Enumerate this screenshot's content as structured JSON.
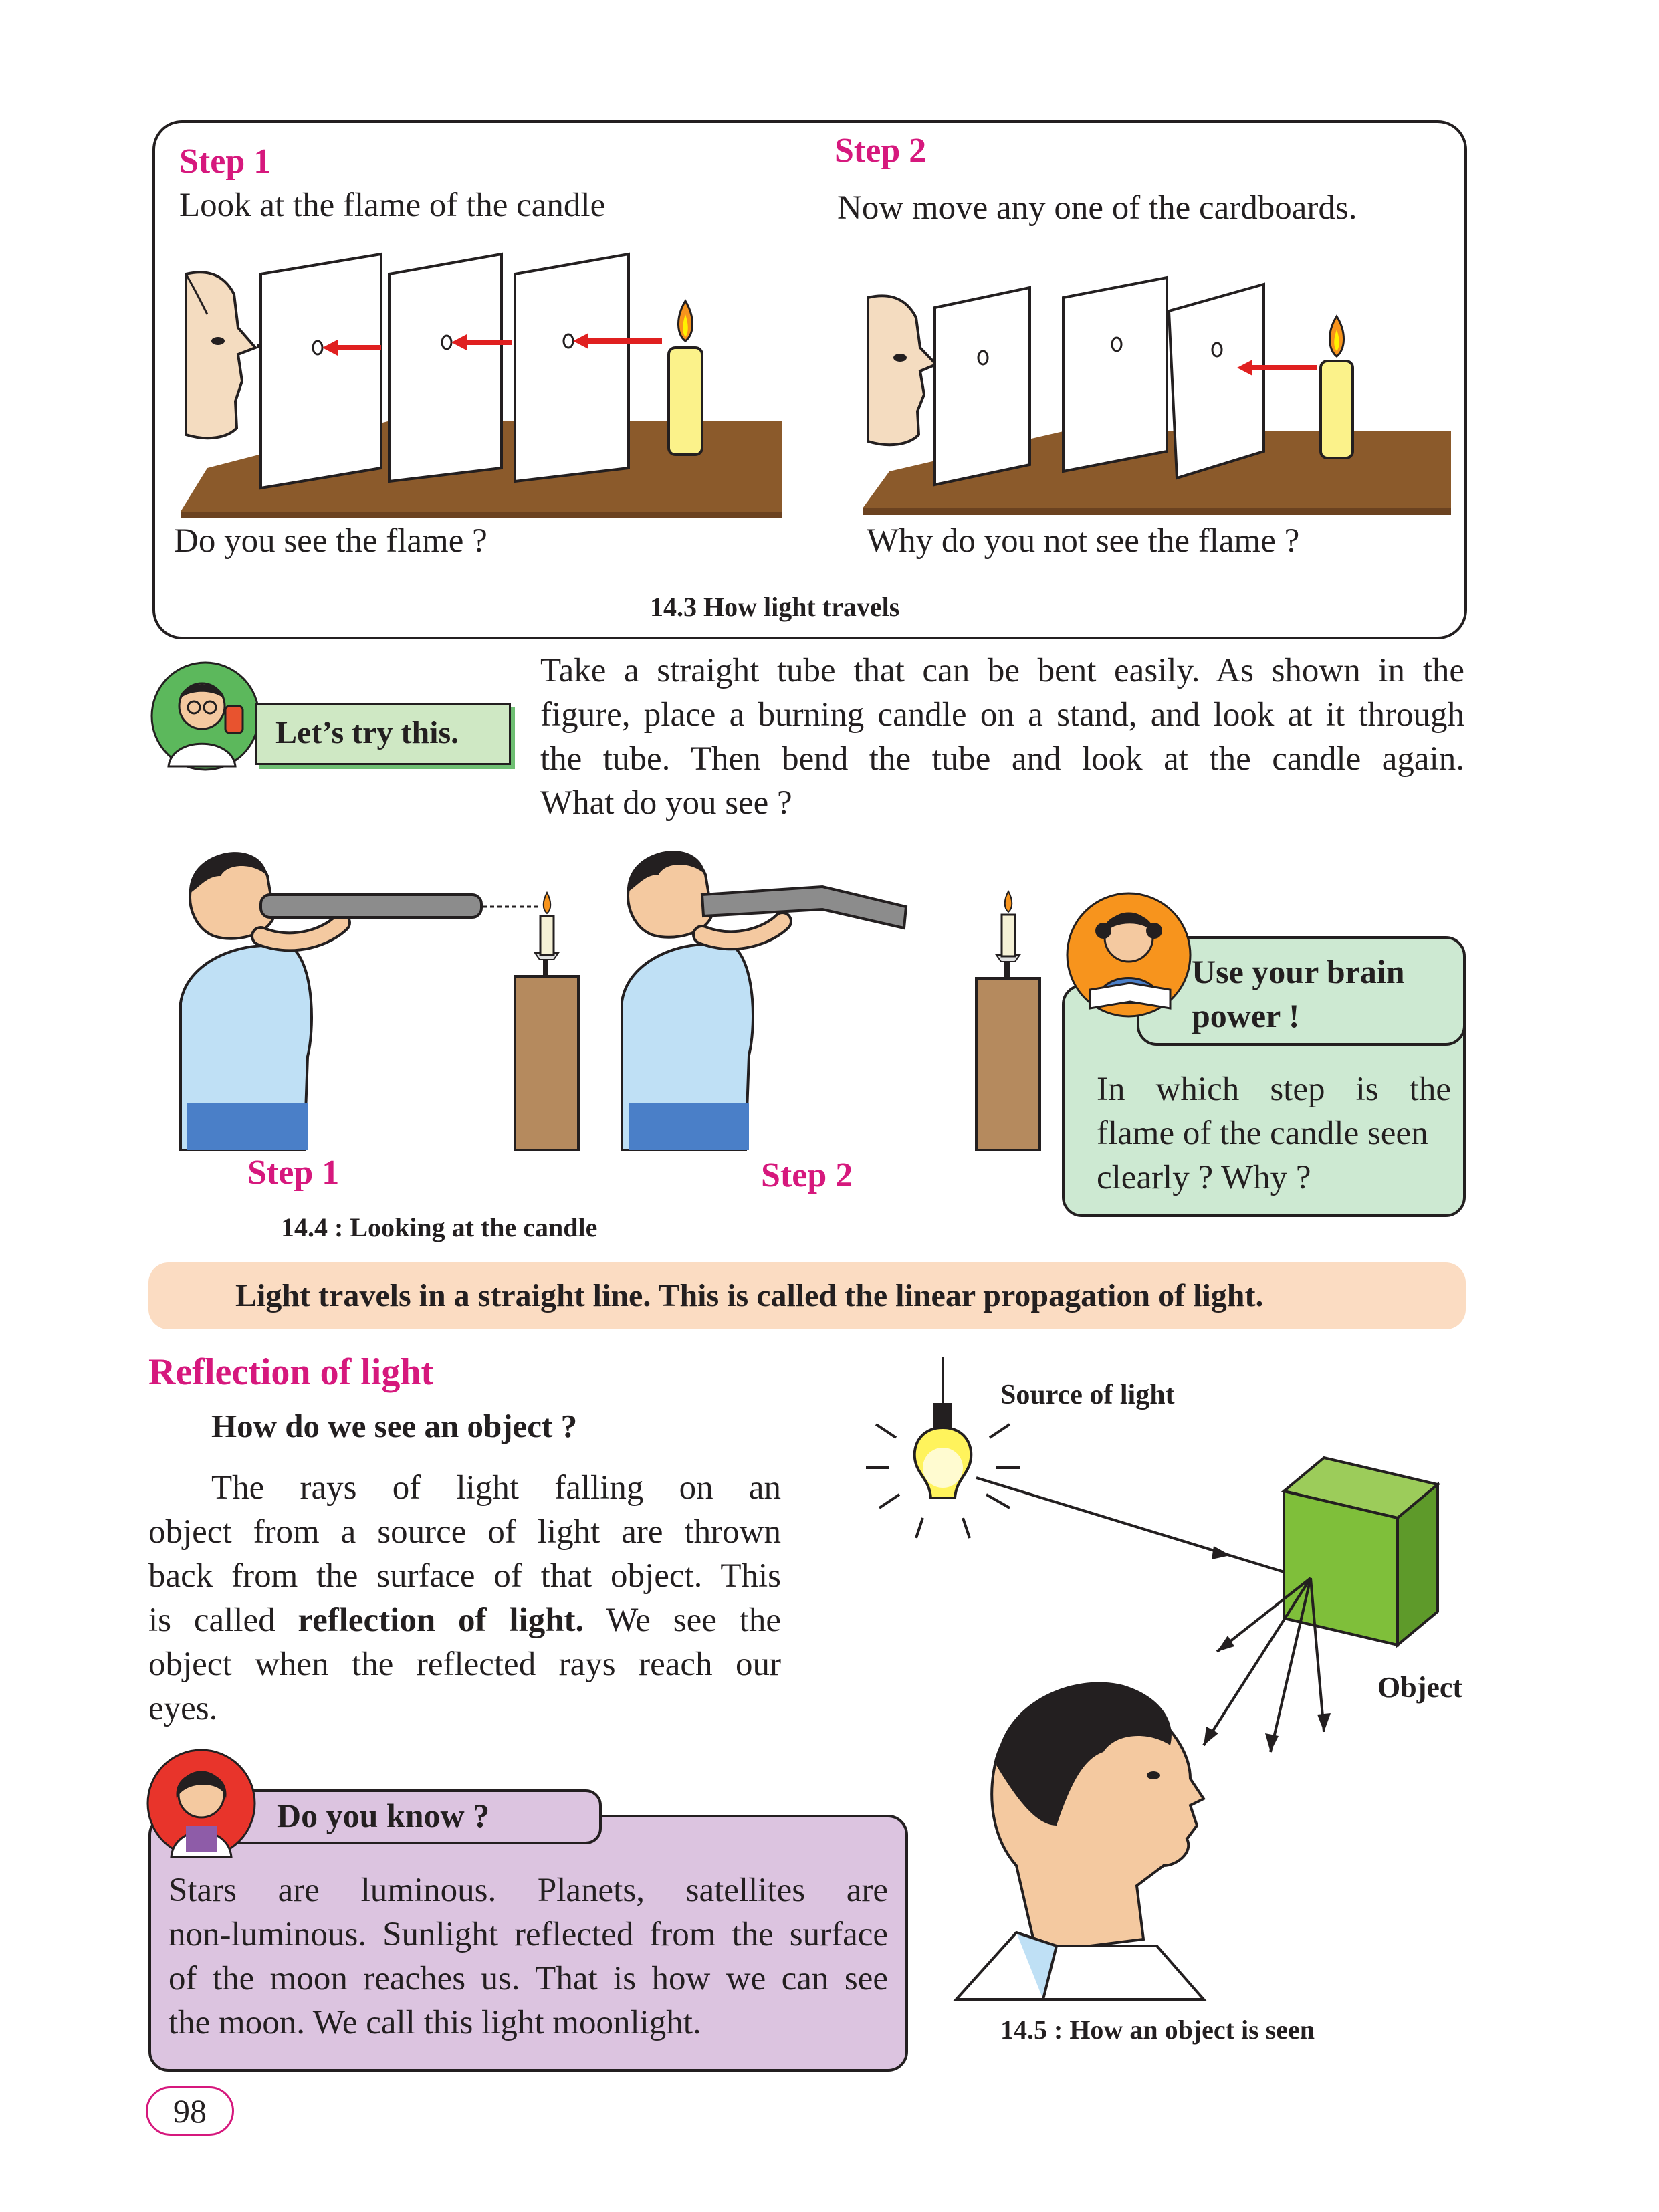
{
  "activity_box": {
    "step1": {
      "title": "Step 1",
      "instruction": "Look at the flame of the candle",
      "question": "Do you see the flame ?"
    },
    "step2": {
      "title": "Step 2",
      "instruction": "Now move any one of the cardboards.",
      "question": "Why do you not see the flame ?"
    },
    "caption": "14.3 How light travels"
  },
  "lets_try": {
    "label": "Let’s try this.",
    "text_lines": [
      "Take a straight tube that can be bent easily. As shown in the",
      "figure, place a burning candle on a stand, and look at it through",
      "the tube. Then bend the tube and look at the candle again.",
      "What do you see ?"
    ]
  },
  "tube_figure": {
    "step1_label": "Step 1",
    "step2_label": "Step 2",
    "caption": "14.4 : Looking at the candle"
  },
  "brain_power": {
    "title_line1": "Use your brain",
    "title_line2": "power !",
    "text_lines": [
      "In which step is the",
      "flame of the candle seen",
      "clearly ? Why ?"
    ]
  },
  "highlight": "Light travels in a straight line. This is called the linear propagation of light.",
  "reflection": {
    "heading": "Reflection of light",
    "subheading": "How do we see an object ?",
    "para_line1": "The rays of light falling on an",
    "para_line2": "object from a source of light are thrown",
    "para_line3": "back from the surface of that object. This",
    "para_line4_a": "is called",
    "para_line4_bold": "reflection of light.",
    "para_line4_b": "We see the",
    "para_line5": "object when the reflected rays reach our",
    "para_line6": "eyes."
  },
  "object_figure": {
    "source_label": "Source of light",
    "object_label": "Object",
    "caption": "14.5 : How an object is seen"
  },
  "do_you_know": {
    "title": "Do you know ?",
    "text_lines": [
      "Stars are luminous. Planets, satellites are",
      "non-luminous. Sunlight reflected from the surface",
      "of the moon reaches us. That is how we can see",
      "the moon. We call this light moonlight."
    ]
  },
  "page_number": "98",
  "colors": {
    "accent_pink": "#d6187d",
    "lets_try_green": "#cfe8c4",
    "brain_box_green": "#cde9d2",
    "highlight_peach": "#fbdcc2",
    "dyk_lilac": "#dcc4e0",
    "table_brown": "#8b5a2b"
  }
}
